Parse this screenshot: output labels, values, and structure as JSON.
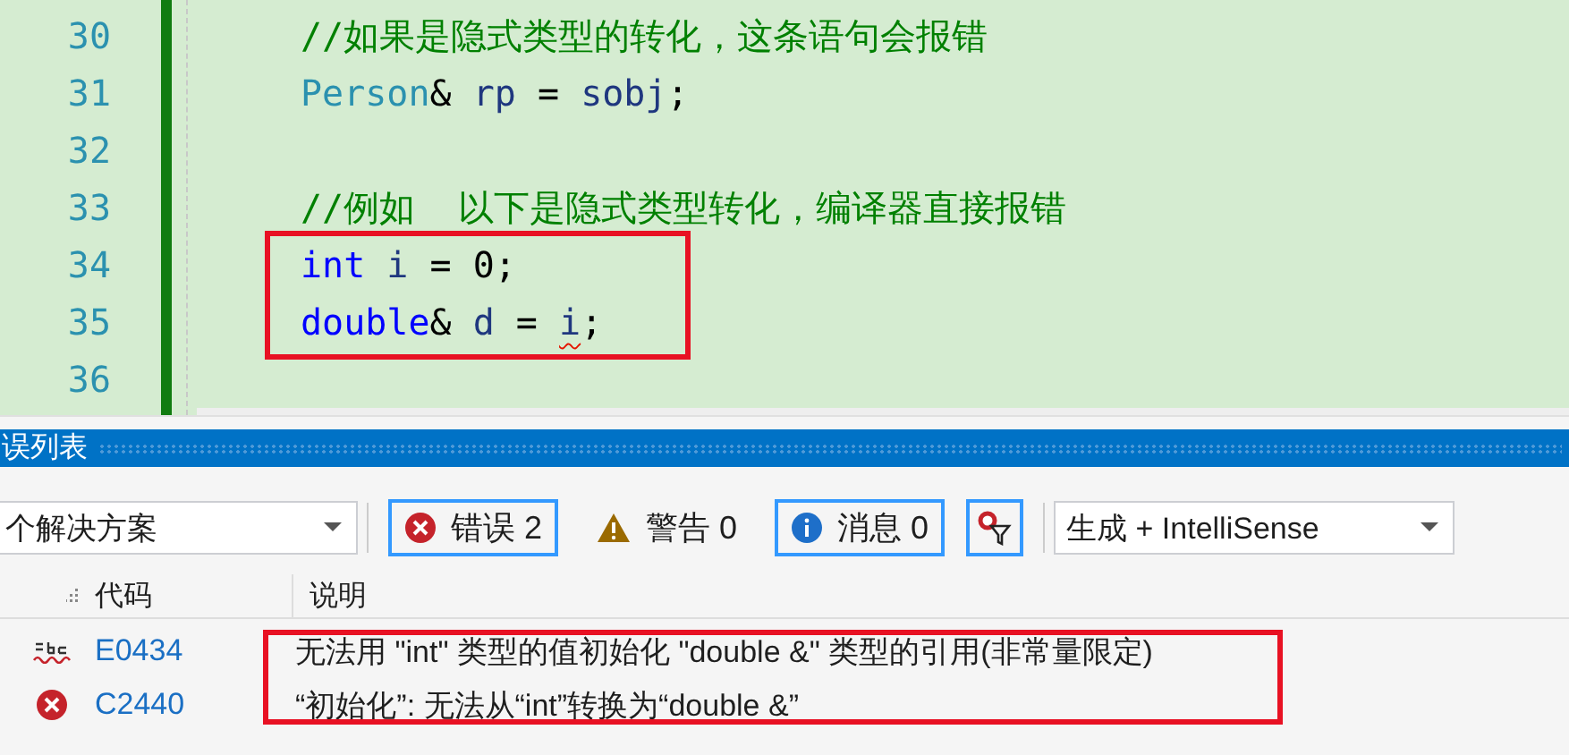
{
  "editor": {
    "lines": [
      {
        "number": "30",
        "boxed": false,
        "tokens": [
          {
            "kind": "comment",
            "text": "//如果是隐式类型的转化，这条语句会报错"
          }
        ]
      },
      {
        "number": "31",
        "boxed": false,
        "tokens": [
          {
            "kind": "type",
            "text": "Person"
          },
          {
            "kind": "plain",
            "text": "& "
          },
          {
            "kind": "var",
            "text": "rp"
          },
          {
            "kind": "plain",
            "text": " = "
          },
          {
            "kind": "var",
            "text": "sobj"
          },
          {
            "kind": "plain",
            "text": ";"
          }
        ]
      },
      {
        "number": "32",
        "boxed": false
      },
      {
        "number": "33",
        "boxed": false,
        "tokens": [
          {
            "kind": "comment",
            "text": "//例如  以下是隐式类型转化，编译器直接报错"
          }
        ]
      },
      {
        "number": "34",
        "boxed": true,
        "tokens": [
          {
            "kind": "keyword",
            "text": "int"
          },
          {
            "kind": "var",
            "text": " i"
          },
          {
            "kind": "plain",
            "text": " = 0;"
          }
        ]
      },
      {
        "number": "35",
        "boxed": true,
        "tokens": [
          {
            "kind": "keyword",
            "text": "double"
          },
          {
            "kind": "plain",
            "text": "& "
          },
          {
            "kind": "var",
            "text": "d"
          },
          {
            "kind": "plain",
            "text": " = "
          },
          {
            "kind": "error",
            "text": "i"
          },
          {
            "kind": "plain",
            "text": ";"
          }
        ]
      },
      {
        "number": "36",
        "boxed": false
      }
    ]
  },
  "error_list": {
    "title": "误列表",
    "toolbar": [
      {
        "kind": "dropdown",
        "label": "个解决方案"
      },
      {
        "kind": "errors",
        "label": "错误 2",
        "selected": true
      },
      {
        "kind": "warnings",
        "label": "警告 0",
        "selected": false
      },
      {
        "kind": "messages",
        "label": "消息 0",
        "selected": true
      },
      {
        "kind": "filter",
        "selected": true
      },
      {
        "kind": "dropdown",
        "label": "生成 + IntelliSense"
      }
    ],
    "columns": [
      "代码",
      "说明"
    ],
    "rows": [
      {
        "kind": "intellisense",
        "code": "E0434",
        "description": "无法用 \"int\" 类型的值初始化 \"double &\" 类型的引用(非常量限定)",
        "boxed": true
      },
      {
        "kind": "build",
        "code": "C2440",
        "description": "“初始化”: 无法从“int”转换为“double &”",
        "boxed": true
      }
    ]
  }
}
